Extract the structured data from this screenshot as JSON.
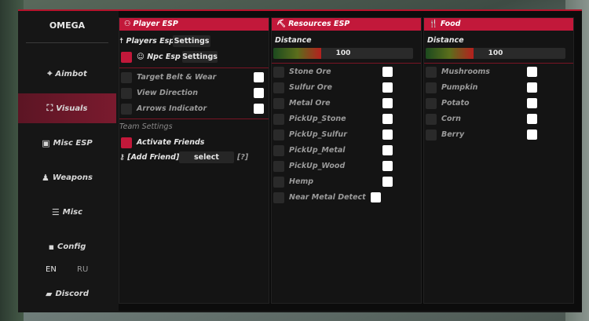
{
  "sidebar": {
    "logo": "OMEGA",
    "items": [
      {
        "label": "Aimbot",
        "icon": "crosshair-icon",
        "glyph": "⌖"
      },
      {
        "label": "Visuals",
        "icon": "visuals-icon",
        "glyph": "⛶"
      },
      {
        "label": "Misc ESP",
        "icon": "monitor-icon",
        "glyph": "▣"
      },
      {
        "label": "Weapons",
        "icon": "weapons-icon",
        "glyph": "♟"
      },
      {
        "label": "Misc",
        "icon": "list-icon",
        "glyph": "☰"
      },
      {
        "label": "Config",
        "icon": "save-icon",
        "glyph": "▪"
      }
    ],
    "lang_en": "EN",
    "lang_ru": "RU",
    "discord": "Discord",
    "discord_glyph": "▰"
  },
  "player_esp": {
    "title": "Player ESP",
    "title_glyph": "⚇",
    "players_esp": "Players Esp",
    "players_glyph": "☨",
    "settings1": "Settings",
    "npc_esp": "Npc Esp",
    "npc_glyph": "☺",
    "settings2": "Settings",
    "options": [
      "Target Belt & Wear",
      "View Direction",
      "Arrows Indicator"
    ],
    "team_settings": "Team Settings",
    "activate_friends": "Activate Friends",
    "add_friend": "[Add Friend]",
    "key_glyph": "⚷",
    "select": "select",
    "help": "[?]"
  },
  "resources_esp": {
    "title": "Resources ESP",
    "title_glyph": "⛏",
    "distance_label": "Distance",
    "distance_value": "100",
    "distance_fraction": 0.34,
    "items": [
      "Stone Ore",
      "Sulfur Ore",
      "Metal Ore",
      "PickUp_Stone",
      "PickUp_Sulfur",
      "PickUp_Metal",
      "PickUp_Wood",
      "Hemp",
      "Near Metal Detect"
    ]
  },
  "food": {
    "title": "Food",
    "title_glyph": "🍴",
    "distance_label": "Distance",
    "distance_value": "100",
    "distance_fraction": 0.34,
    "items": [
      "Mushrooms",
      "Pumpkin",
      "Potato",
      "Corn",
      "Berry"
    ]
  },
  "colors": {
    "accent": "#c2183a",
    "background": "#161616"
  }
}
